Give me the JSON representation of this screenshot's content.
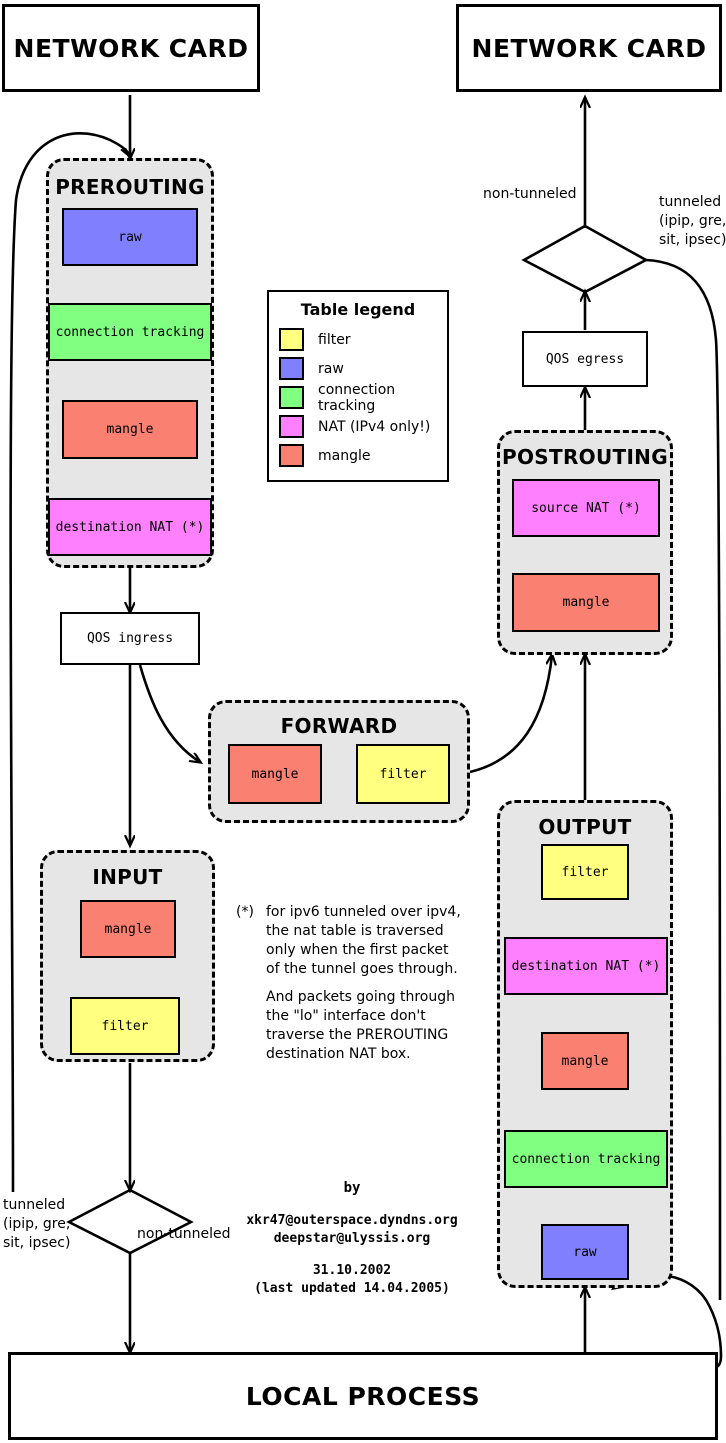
{
  "title": "Netfilter packet flow",
  "colors": {
    "filter": "#ffff80",
    "raw": "#8080ff",
    "conntrack": "#80ff80",
    "nat": "#ff80ff",
    "mangle": "#fa8072",
    "chain_bg": "#e6e6e6",
    "stroke": "#000000",
    "page_bg": "#ffffff"
  },
  "endpoints": {
    "network_card_in": "NETWORK CARD",
    "network_card_out": "NETWORK CARD",
    "local_process": "LOCAL PROCESS"
  },
  "qos": {
    "ingress": "QOS ingress",
    "egress": "QOS egress"
  },
  "chains": {
    "prerouting": {
      "title": "PREROUTING",
      "boxes": [
        {
          "label": "raw",
          "table": "raw"
        },
        {
          "label": "connection tracking",
          "table": "conntrack"
        },
        {
          "label": "mangle",
          "table": "mangle"
        },
        {
          "label": "destination NAT (*)",
          "table": "nat"
        }
      ]
    },
    "forward": {
      "title": "FORWARD",
      "boxes": [
        {
          "label": "mangle",
          "table": "mangle"
        },
        {
          "label": "filter",
          "table": "filter"
        }
      ]
    },
    "input": {
      "title": "INPUT",
      "boxes": [
        {
          "label": "mangle",
          "table": "mangle"
        },
        {
          "label": "filter",
          "table": "filter"
        }
      ]
    },
    "output": {
      "title": "OUTPUT",
      "boxes": [
        {
          "label": "filter",
          "table": "filter"
        },
        {
          "label": "destination NAT (*)",
          "table": "nat"
        },
        {
          "label": "mangle",
          "table": "mangle"
        },
        {
          "label": "connection tracking",
          "table": "conntrack"
        },
        {
          "label": "raw",
          "table": "raw"
        }
      ]
    },
    "postrouting": {
      "title": "POSTROUTING",
      "boxes": [
        {
          "label": "source NAT (*)",
          "table": "nat"
        },
        {
          "label": "mangle",
          "table": "mangle"
        }
      ]
    }
  },
  "legend": {
    "title": "Table legend",
    "items": [
      {
        "label": "filter",
        "color": "#ffff80"
      },
      {
        "label": "raw",
        "color": "#8080ff"
      },
      {
        "label": "connection tracking",
        "color": "#80ff80"
      },
      {
        "label": "NAT  (IPv4 only!)",
        "color": "#ff80ff"
      },
      {
        "label": "mangle",
        "color": "#fa8072"
      }
    ]
  },
  "edge_labels": {
    "bottom_left_tunneled": "tunneled\n(ipip, gre,\nsit, ipsec)",
    "bottom_left_non_tunneled": "non-tunneled",
    "top_right_non_tunneled": "non-tunneled",
    "top_right_tunneled": "tunneled\n(ipip, gre,\nsit, ipsec)"
  },
  "notes": {
    "star": "(*)",
    "paragraph1": "for ipv6 tunneled over ipv4,\nthe nat table is traversed\nonly when the first packet\nof the tunnel goes through.",
    "paragraph2": "And packets going through\nthe \"lo\" interface don't\ntraverse the PREROUTING\ndestination NAT box."
  },
  "credits": {
    "by": "by",
    "email1": "xkr47@outerspace.dyndns.org",
    "email2": "deepstar@ulyssis.org",
    "date": "31.10.2002",
    "updated": "(last updated 14.04.2005)"
  }
}
